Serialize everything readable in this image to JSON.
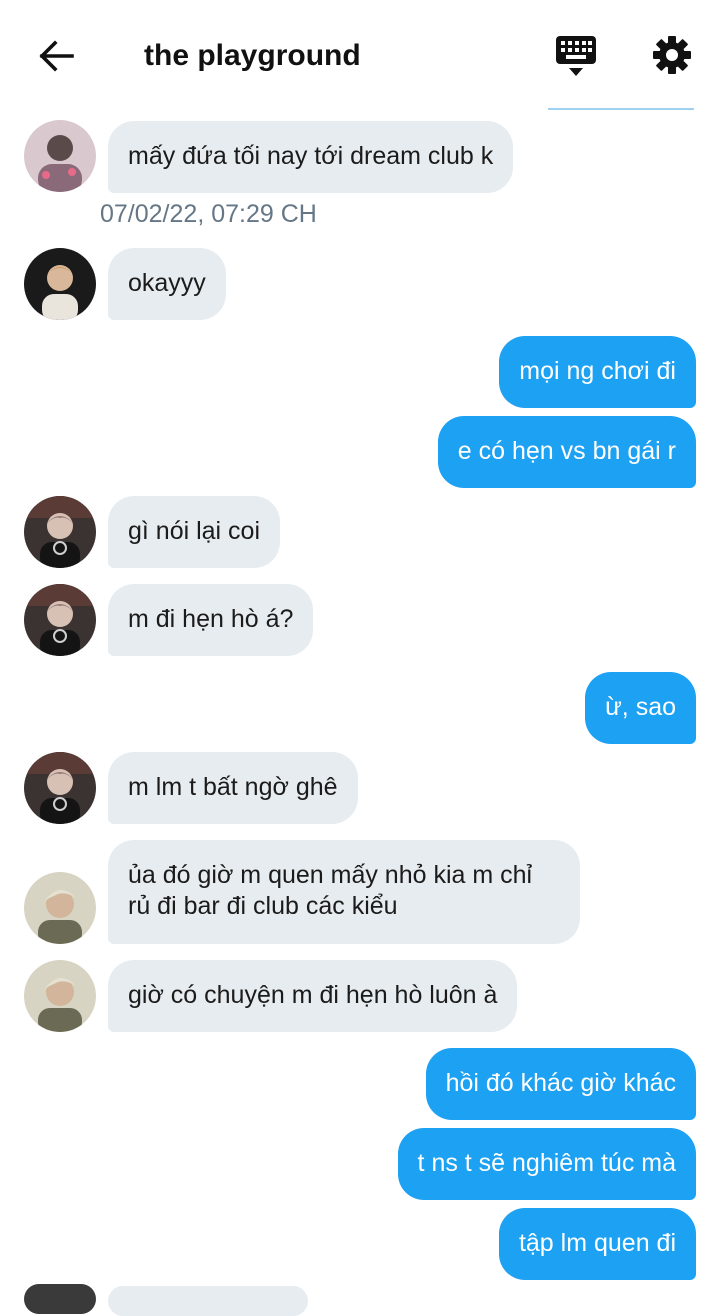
{
  "header": {
    "title": "the playground"
  },
  "messages": {
    "m1": "mấy đứa tối nay tới dream club k",
    "timestamp": "07/02/22, 07:29 CH",
    "m2": "okayyy",
    "m3": "mọi ng chơi đi",
    "m4": "e có hẹn vs bn gái r",
    "m5": "gì nói lại coi",
    "m6": "m đi hẹn hò á?",
    "m7": "ừ, sao",
    "m8": "m lm t bất ngờ ghê",
    "m9": "ủa đó giờ m quen mấy nhỏ kia m chỉ rủ đi bar đi club các kiểu",
    "m10": "giờ có chuyện m đi hẹn hò luôn à",
    "m11": "hồi đó khác giờ khác",
    "m12": "t ns t sẽ nghiêm túc mà",
    "m13": "tập lm quen đi"
  },
  "colors": {
    "outgoing": "#1da1f2",
    "incoming": "#e6ecf0",
    "timestamp": "#657786"
  },
  "icons": {
    "back": "arrow-left-icon",
    "keyboard": "keyboard-icon",
    "settings": "gear-icon"
  }
}
